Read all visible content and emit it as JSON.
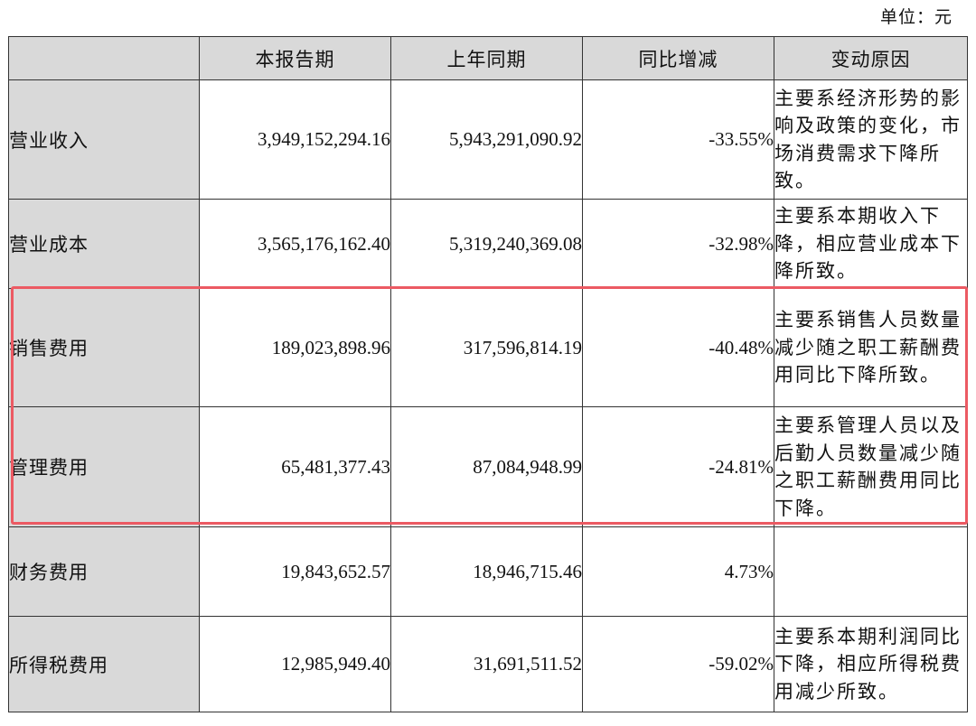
{
  "unit_label": "单位：元",
  "header": {
    "col0": "",
    "col1": "本报告期",
    "col2": "上年同期",
    "col3": "同比增减",
    "col4": "变动原因"
  },
  "rows": [
    {
      "item": "营业收入",
      "current": "3,949,152,294.16",
      "prior": "5,943,291,090.92",
      "change": "-33.55%",
      "reason": "主要系经济形势的影响及政策的变化，市场消费需求下降所致。"
    },
    {
      "item": "营业成本",
      "current": "3,565,176,162.40",
      "prior": "5,319,240,369.08",
      "change": "-32.98%",
      "reason": "主要系本期收入下降，相应营业成本下降所致。"
    },
    {
      "item": "销售费用",
      "current": "189,023,898.96",
      "prior": "317,596,814.19",
      "change": "-40.48%",
      "reason": "主要系销售人员数量减少随之职工薪酬费用同比下降所致。"
    },
    {
      "item": "管理费用",
      "current": "65,481,377.43",
      "prior": "87,084,948.99",
      "change": "-24.81%",
      "reason": "主要系管理人员以及后勤人员数量减少随之职工薪酬费用同比下降。"
    },
    {
      "item": "财务费用",
      "current": "19,843,652.57",
      "prior": "18,946,715.46",
      "change": "4.73%",
      "reason": ""
    },
    {
      "item": "所得税费用",
      "current": "12,985,949.40",
      "prior": "31,691,511.52",
      "change": "-59.02%",
      "reason": "主要系本期利润同比下降，相应所得税费用减少所致。"
    }
  ],
  "highlight_color": "#ec5a63",
  "label_fill_color": "#d9d9d9"
}
